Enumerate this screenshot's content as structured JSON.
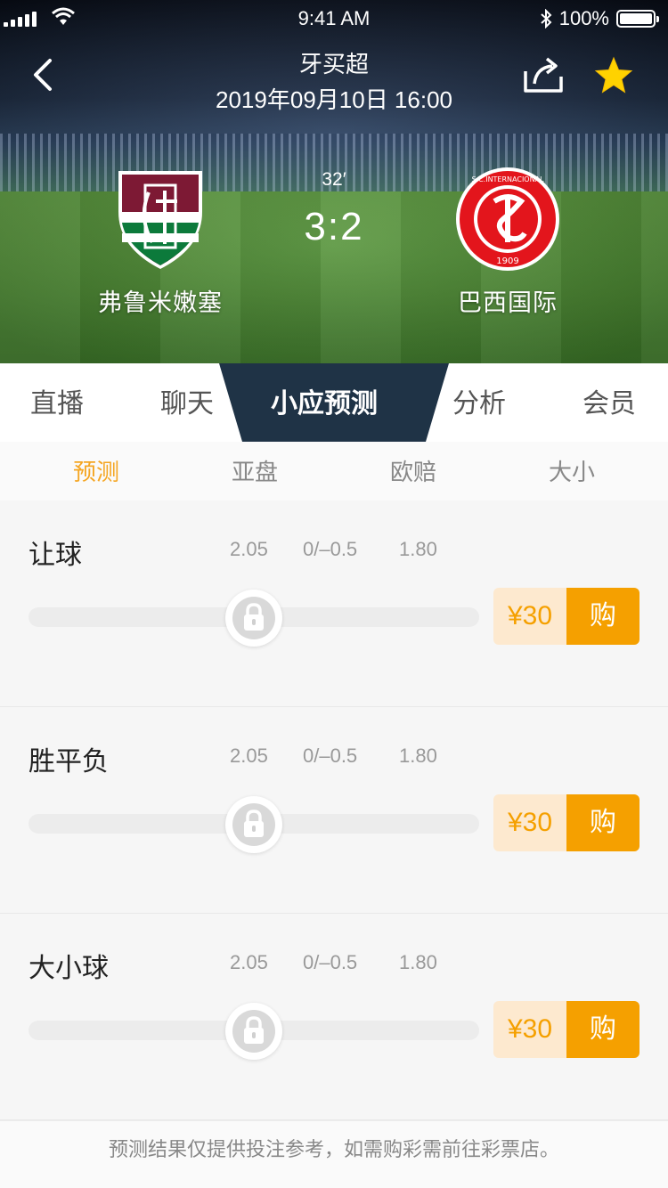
{
  "status_bar": {
    "time": "9:41 AM",
    "battery": "100%"
  },
  "nav": {
    "title": "牙买超",
    "datetime": "2019年09月10日  16:00"
  },
  "match": {
    "minute": "32′",
    "score": "3:2",
    "home": {
      "name": "弗鲁米嫩塞"
    },
    "away": {
      "name": "巴西国际",
      "logo_text": "S.C.INTERNACIONAL",
      "logo_year": "1909"
    }
  },
  "tabs": [
    {
      "label": "直播"
    },
    {
      "label": "聊天"
    },
    {
      "label": "小应预测",
      "active": true
    },
    {
      "label": "分析"
    },
    {
      "label": "会员"
    }
  ],
  "subtabs": [
    {
      "label": "预测",
      "active": true
    },
    {
      "label": "亚盘"
    },
    {
      "label": "欧赔"
    },
    {
      "label": "大小"
    }
  ],
  "sections": [
    {
      "title": "让球",
      "odds": [
        "2.05",
        "0/–0.5",
        "1.80"
      ],
      "price": "¥30",
      "buy_label": "购"
    },
    {
      "title": "胜平负",
      "odds": [
        "2.05",
        "0/–0.5",
        "1.80"
      ],
      "price": "¥30",
      "buy_label": "购"
    },
    {
      "title": "大小球",
      "odds": [
        "2.05",
        "0/–0.5",
        "1.80"
      ],
      "price": "¥30",
      "buy_label": "购"
    }
  ],
  "footer": {
    "note": "预测结果仅提供投注参考，如需购彩需前往彩票店。"
  },
  "colors": {
    "accent": "#f5a000",
    "price_bg": "#fde9cf",
    "tab_active_bg": "#1f3346",
    "star": "#ffd200"
  }
}
